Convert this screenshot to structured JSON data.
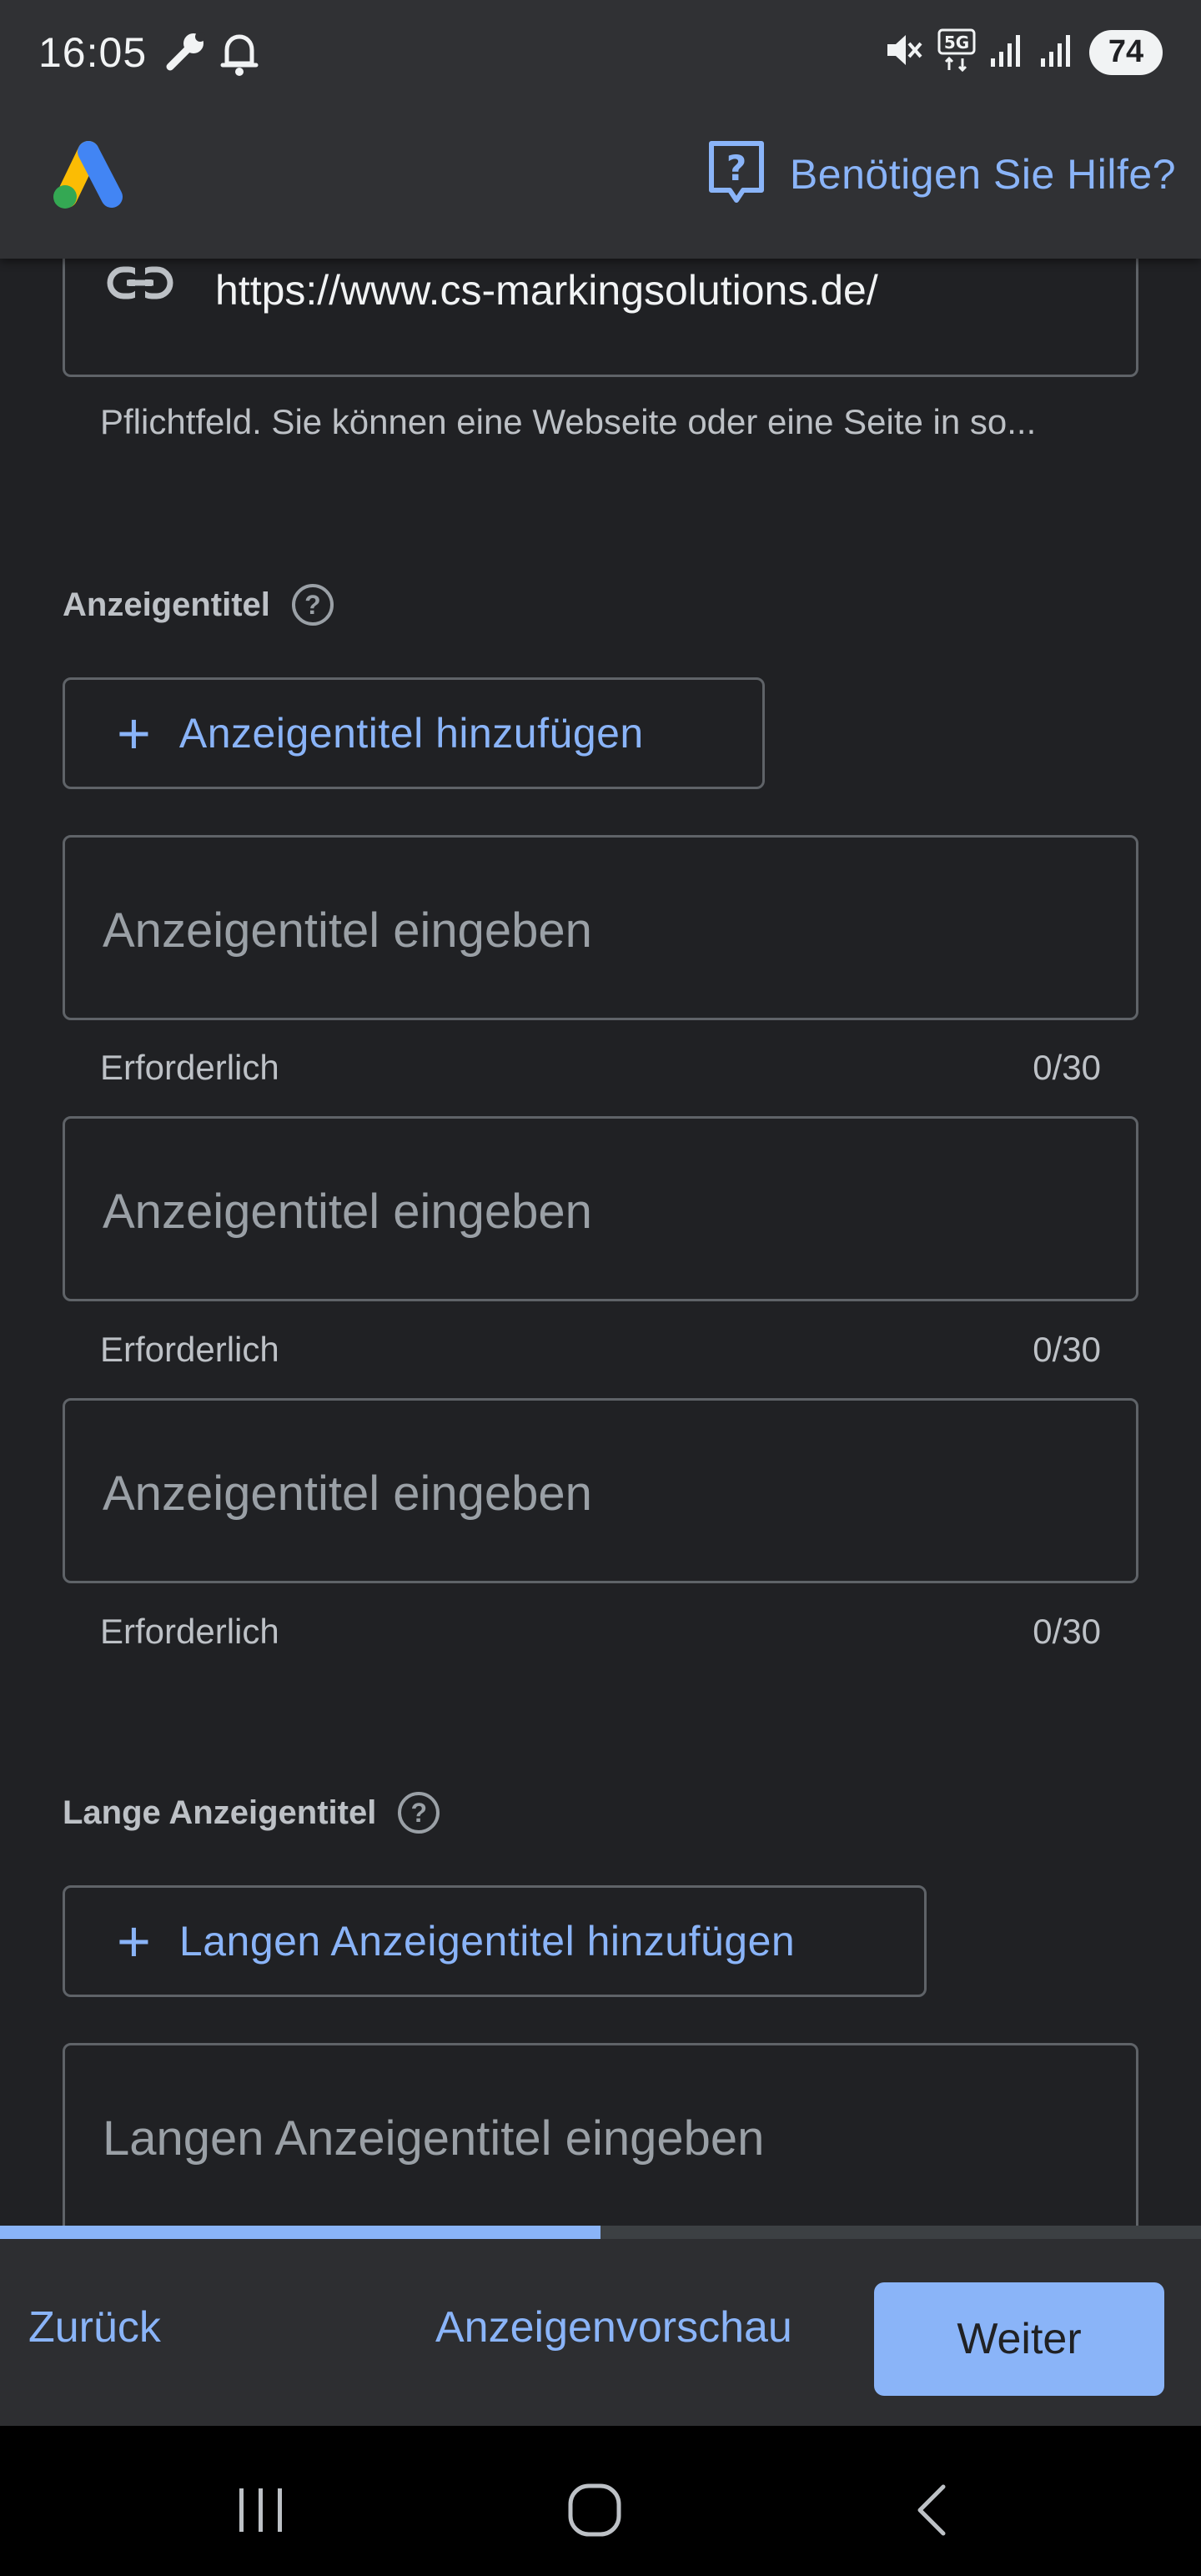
{
  "status_bar": {
    "time": "16:05",
    "battery": "74",
    "icons": [
      "wrench-icon",
      "bell-icon",
      "mute-icon",
      "5g-icon",
      "signal-icon",
      "signal-icon"
    ]
  },
  "app_bar": {
    "help_label": "Benötigen Sie Hilfe?"
  },
  "url_field": {
    "value": "https://www.cs-markingsolutions.de/",
    "hint": "Pflichtfeld. Sie können eine Webseite oder eine Seite in so..."
  },
  "headlines": {
    "label": "Anzeigentitel",
    "add_label": "Anzeigentitel hinzufügen",
    "inputs": [
      {
        "placeholder": "Anzeigentitel eingeben",
        "helper": "Erforderlich",
        "counter": "0/30"
      },
      {
        "placeholder": "Anzeigentitel eingeben",
        "helper": "Erforderlich",
        "counter": "0/30"
      },
      {
        "placeholder": "Anzeigentitel eingeben",
        "helper": "Erforderlich",
        "counter": "0/30"
      }
    ]
  },
  "long_headlines": {
    "label": "Lange Anzeigentitel",
    "add_label": "Langen Anzeigentitel hinzufügen",
    "inputs": [
      {
        "placeholder": "Langen Anzeigentitel eingeben"
      }
    ]
  },
  "progress": {
    "fraction": 0.5
  },
  "actions": {
    "back_label": "Zurück",
    "preview_label": "Anzeigenvorschau",
    "next_label": "Weiter"
  },
  "colors": {
    "accent": "#8ab4f8",
    "background": "#202124",
    "surface": "#303134",
    "border": "#5f6368"
  }
}
